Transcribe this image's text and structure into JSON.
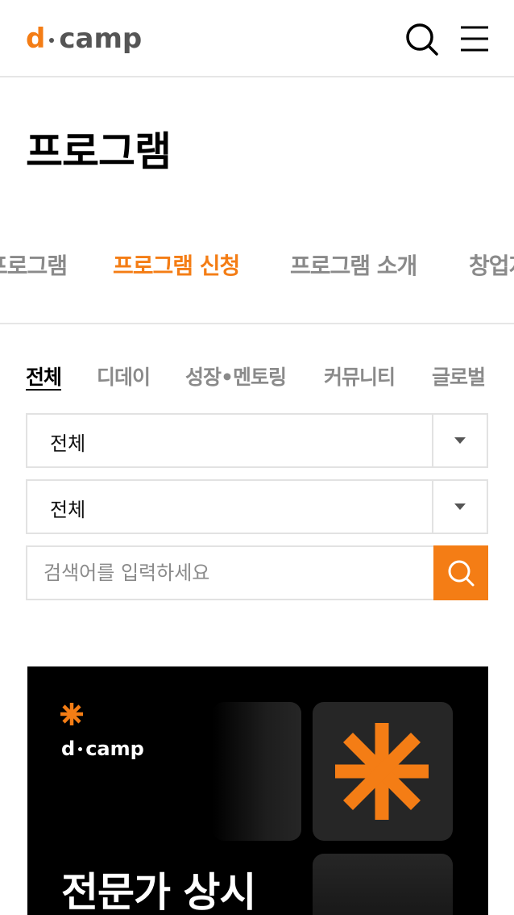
{
  "header": {
    "logo_d": "d",
    "logo_camp": "camp",
    "search_icon": "search-icon",
    "menu_icon": "hamburger-menu-icon"
  },
  "page": {
    "title": "프로그램"
  },
  "tabs": [
    {
      "label": "프로그램",
      "active": false
    },
    {
      "label": "프로그램 신청",
      "active": true
    },
    {
      "label": "프로그램 소개",
      "active": false
    },
    {
      "label": "창업지",
      "active": false
    }
  ],
  "categories": [
    {
      "label": "전체",
      "active": true
    },
    {
      "label": "디데이",
      "active": false
    },
    {
      "label": "성장•멘토링",
      "active": false
    },
    {
      "label": "커뮤니티",
      "active": false
    },
    {
      "label": "글로벌",
      "active": false
    }
  ],
  "filters": {
    "select1_value": "전체",
    "select2_value": "전체"
  },
  "search": {
    "placeholder": "검색어를 입력하세요",
    "value": ""
  },
  "banner": {
    "logo_d": "d",
    "logo_camp": "camp",
    "headline": "전문가 상시"
  },
  "colors": {
    "accent": "#f47d15",
    "muted_text": "#8a8a8a",
    "border": "#e2e2e2"
  }
}
